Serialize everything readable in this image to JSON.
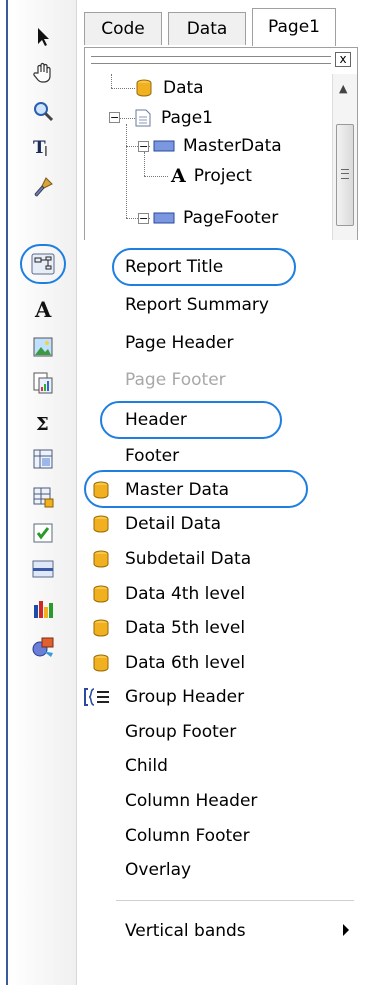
{
  "tabs": [
    {
      "label": "Code",
      "active": false
    },
    {
      "label": "Data",
      "active": false
    },
    {
      "label": "Page1",
      "active": true
    }
  ],
  "tree": {
    "close_label": "x",
    "nodes": [
      {
        "label": "Data",
        "icon": "database-icon"
      },
      {
        "label": "Page1",
        "icon": "page-icon"
      },
      {
        "label": "MasterData",
        "icon": "band-icon"
      },
      {
        "label": "Project",
        "icon": "text-object-icon"
      },
      {
        "label": "PageFooter",
        "icon": "band-icon"
      }
    ]
  },
  "toolbar": [
    {
      "name": "select-tool-icon"
    },
    {
      "name": "hand-tool-icon"
    },
    {
      "name": "zoom-tool-icon"
    },
    {
      "name": "text-edit-tool-icon"
    },
    {
      "name": "format-painter-icon"
    },
    {
      "name": "insert-band-icon",
      "selected": true
    },
    {
      "name": "text-object-icon"
    },
    {
      "name": "picture-object-icon"
    },
    {
      "name": "subreport-icon"
    },
    {
      "name": "system-text-icon"
    },
    {
      "name": "cross-tab-icon"
    },
    {
      "name": "table-object-icon"
    },
    {
      "name": "checkbox-object-icon"
    },
    {
      "name": "line-object-icon"
    },
    {
      "name": "chart-object-icon"
    },
    {
      "name": "more-objects-icon"
    }
  ],
  "menu": {
    "items": [
      {
        "label": "Report Title",
        "icon": null,
        "disabled": false,
        "highlighted": true
      },
      {
        "label": "Report Summary",
        "icon": null,
        "disabled": false
      },
      {
        "label": "Page Header",
        "icon": null,
        "disabled": false
      },
      {
        "label": "Page Footer",
        "icon": null,
        "disabled": true
      },
      {
        "label": "Header",
        "icon": null,
        "disabled": false,
        "highlighted": true
      },
      {
        "label": "Footer",
        "icon": null,
        "disabled": false
      },
      {
        "label": "Master Data",
        "icon": "database-icon",
        "disabled": false,
        "highlighted": true
      },
      {
        "label": "Detail Data",
        "icon": "database-icon",
        "disabled": false
      },
      {
        "label": "Subdetail Data",
        "icon": "database-icon",
        "disabled": false
      },
      {
        "label": "Data 4th level",
        "icon": "database-icon",
        "disabled": false
      },
      {
        "label": "Data 5th level",
        "icon": "database-icon",
        "disabled": false
      },
      {
        "label": "Data 6th level",
        "icon": "database-icon",
        "disabled": false
      },
      {
        "label": "Group Header",
        "icon": "group-header-icon",
        "disabled": false
      },
      {
        "label": "Group Footer",
        "icon": null,
        "disabled": false
      },
      {
        "label": "Child",
        "icon": null,
        "disabled": false
      },
      {
        "label": "Column Header",
        "icon": null,
        "disabled": false
      },
      {
        "label": "Column Footer",
        "icon": null,
        "disabled": false
      },
      {
        "label": "Overlay",
        "icon": null,
        "disabled": false
      }
    ],
    "submenu": {
      "label": "Vertical bands",
      "icon": "chevron-right-icon"
    }
  },
  "colors": {
    "highlight_oval": "#1e7fe0",
    "database_icon": "#f0b020",
    "band_icon": "#5b7fd0",
    "disabled_text": "#a8a8a8"
  }
}
